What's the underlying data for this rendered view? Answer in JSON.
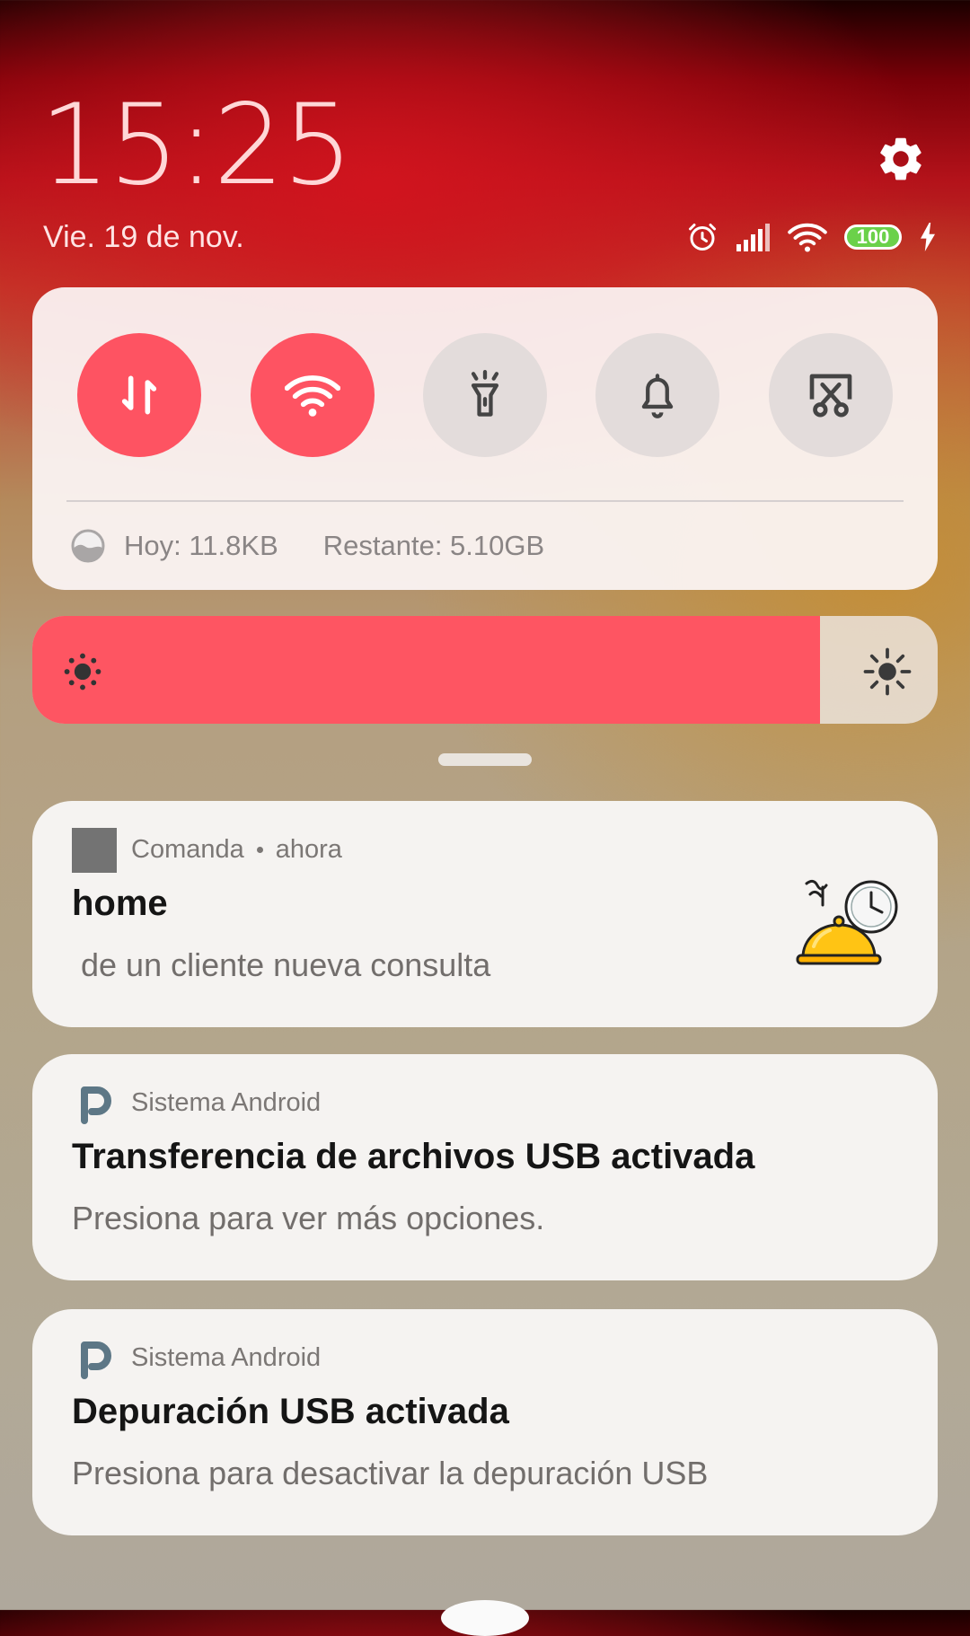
{
  "lock_header": {
    "time": "15:25",
    "date": "Vie. 19 de nov.",
    "battery_level": "100",
    "icons": [
      "gear-icon",
      "alarm-clock-icon",
      "signal-icon",
      "wifi-icon",
      "charging-bolt-icon"
    ]
  },
  "quick_settings": {
    "toggles": [
      {
        "icon": "mobile-data-icon",
        "state": "on"
      },
      {
        "icon": "wifi-icon",
        "state": "on"
      },
      {
        "icon": "flashlight-icon",
        "state": "off"
      },
      {
        "icon": "bell-icon",
        "state": "off"
      },
      {
        "icon": "screenshot-icon",
        "state": "off"
      }
    ],
    "data_today": "Hoy: 11.8KB",
    "data_remaining": "Restante: 5.10GB"
  },
  "brightness": {
    "level": 0.87,
    "icons": [
      "brightness-low-icon",
      "brightness-high-icon"
    ]
  },
  "notifications": [
    {
      "app": "Comanda",
      "time": "ahora",
      "title": "home",
      "body": " de un cliente nueva consulta",
      "icon": "app-placeholder-icon",
      "thumbnail": "food-cloche-clock-icon"
    },
    {
      "app": "Sistema Android",
      "title": "Transferencia de archivos USB activada",
      "body": "Presiona para ver más opciones.",
      "icon": "android-system-icon"
    },
    {
      "app": "Sistema Android",
      "title": "Depuración USB activada",
      "body": "Presiona para desactivar la depuración USB",
      "icon": "android-system-icon"
    }
  ],
  "colors": {
    "accent": "#fe5362",
    "toggle_off": "#e3dcdb",
    "card": "#f5f3f1"
  }
}
